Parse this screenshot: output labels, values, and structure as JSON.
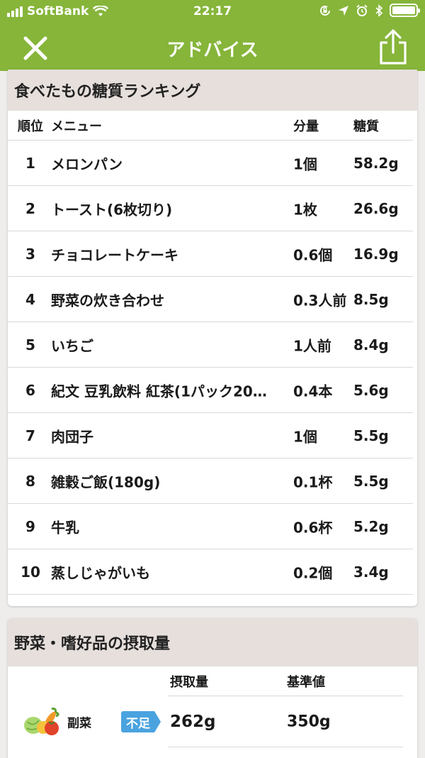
{
  "status_bar": {
    "carrier": "SoftBank",
    "time": "22:17"
  },
  "nav": {
    "title": "アドバイス"
  },
  "ranking": {
    "title": "食べたもの糖質ランキング",
    "headers": {
      "rank": "順位",
      "menu": "メニュー",
      "qty": "分量",
      "sugar": "糖質"
    },
    "rows": [
      {
        "rank": "1",
        "menu": "メロンパン",
        "qty": "1個",
        "sugar": "58.2g"
      },
      {
        "rank": "2",
        "menu": "トースト(6枚切り)",
        "qty": "1枚",
        "sugar": "26.6g"
      },
      {
        "rank": "3",
        "menu": "チョコレートケーキ",
        "qty": "0.6個",
        "sugar": "16.9g"
      },
      {
        "rank": "4",
        "menu": "野菜の炊き合わせ",
        "qty": "0.3人前",
        "sugar": "8.5g"
      },
      {
        "rank": "5",
        "menu": "いちご",
        "qty": "1人前",
        "sugar": "8.4g"
      },
      {
        "rank": "6",
        "menu": "紀文 豆乳飲料 紅茶(1パック20…",
        "qty": "0.4本",
        "sugar": "5.6g"
      },
      {
        "rank": "7",
        "menu": "肉団子",
        "qty": "1個",
        "sugar": "5.5g"
      },
      {
        "rank": "8",
        "menu": "雑穀ご飯(180g)",
        "qty": "0.1杯",
        "sugar": "5.5g"
      },
      {
        "rank": "9",
        "menu": "牛乳",
        "qty": "0.6杯",
        "sugar": "5.2g"
      },
      {
        "rank": "10",
        "menu": "蒸しじゃがいも",
        "qty": "0.2個",
        "sugar": "3.4g"
      }
    ]
  },
  "vegetables": {
    "title": "野菜・嗜好品の摂取量",
    "headers": {
      "intake": "摂取量",
      "standard": "基準値"
    },
    "rows": [
      {
        "label": "副菜",
        "status": "不足",
        "intake": "262g",
        "standard": "350g"
      }
    ]
  },
  "colors": {
    "header_green": "#86b53a",
    "section_header_bg": "#e6dfdc",
    "badge_blue": "#4aa3df"
  }
}
